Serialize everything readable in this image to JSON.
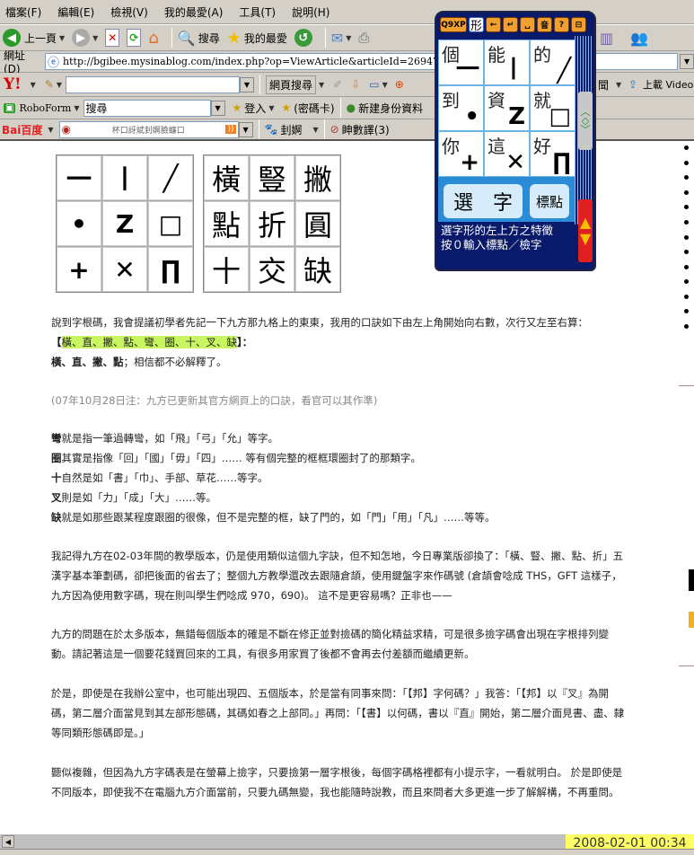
{
  "menu": [
    "檔案(F)",
    "編輯(E)",
    "檢視(V)",
    "我的最愛(A)",
    "工具(T)",
    "說明(H)"
  ],
  "toolbar": {
    "back": "上一頁",
    "search": "搜尋",
    "favorites": "我的最愛"
  },
  "address": {
    "label": "網址(D)",
    "url": "http://bgibee.mysinablog.com/index.php?op=ViewArticle&articleId=269475"
  },
  "yahoo": {
    "logo": "Y!",
    "search_value": "",
    "web_search": "網頁搜尋",
    "news": "聞",
    "upload": "上載 Video"
  },
  "roboform": {
    "label": "RoboForm",
    "search_value": "搜尋",
    "login": "登入",
    "passcard": "(密碼卡)",
    "new_identity": "新建身份資料"
  },
  "baidu": {
    "logo": "Bai百度",
    "input_text": "杯口訝斌刲婀臉蠊口",
    "btn1": "刲婀",
    "btn2": "眒數譯(3)"
  },
  "ime": {
    "buttons": [
      "Q9XP",
      "形",
      "←",
      "↵",
      "␣",
      "音",
      "?",
      "⊟"
    ],
    "cells": [
      {
        "char": "個",
        "stroke": "一"
      },
      {
        "char": "能",
        "stroke": "丨"
      },
      {
        "char": "的",
        "stroke": "╱"
      },
      {
        "char": "到",
        "stroke": "•"
      },
      {
        "char": "資",
        "stroke": "Z"
      },
      {
        "char": "就",
        "stroke": "□"
      },
      {
        "char": "你",
        "stroke": "+"
      },
      {
        "char": "這",
        "stroke": "✕"
      },
      {
        "char": "好",
        "stroke": "∏"
      }
    ],
    "select_label": "選　字",
    "punct_label": "標點",
    "hint_line1": "選字形的左上方之特徵",
    "hint_line2": "按０輸入標點／檢字"
  },
  "stroke_grid": [
    "一",
    "丨",
    "╱",
    "•",
    "Z",
    "□",
    "+",
    "✕",
    "∏"
  ],
  "name_grid": [
    "橫",
    "豎",
    "撇",
    "點",
    "折",
    "圓",
    "十",
    "交",
    "缺"
  ],
  "article": {
    "p1": "說到字根碼，我會提議初學者先記一下九方那九格上的東東，我用的口訣如下由左上角開始向右數，次行又左至右算：",
    "p1_open": "【",
    "p1_hl": "橫、直、撇、點、彎、圈、十、叉、缺",
    "p1_close": "】：",
    "p1_b": "橫、直、撇、點",
    "p1_rest": "；相信都不必解釋了。",
    "note": "(07年10月28日注：九方已更新其官方網頁上的口訣，看官可以其作準)",
    "l1_b": "彎",
    "l1": "就是指一筆過轉彎，如「飛」「弓」「允」等字。",
    "l2_b": "圈",
    "l2": "其實是指像「回」「國」「毋」「四」…… 等有個完整的框框環圈封了的那類字。",
    "l3_b": "十",
    "l3": "自然是如「書」「巾」、手部、草花……等字。",
    "l4_b": "叉",
    "l4": "則是如「力」「成」「大」……等。",
    "l5_b": "缺",
    "l5": "就是如那些跟某程度跟圈的很像，但不是完整的框，缺了門的，如「門」「用」「凡」……等等。",
    "p3": "我記得九方在02-03年間的教學版本，仍是使用類似這個九字訣，但不知怎地，今日專業版卻換了：「橫、豎、撇、點、折」五漢字基本筆劃碼，卻把後面的省去了；整個九方教學還改去跟隨倉頡，使用鍵盤字來作碼號 (倉頡會唸成 THS，GFT 這樣子，九方因為使用數字碼，現在則叫學生們唸成 970，690)。 這不是更容易嗎？正非也——",
    "p4": "九方的問題在於太多版本，無錯每個版本的確是不斷在修正並對撿碼的簡化精益求精，可是很多撿字碼會出現在字根排列變動。請記著這是一個要花錢買回來的工具，有很多用家買了後都不會再去付差額而繼續更新。",
    "p5": "於是，即使是在我辦公室中，也可能出現四、五個版本，於是當有同事來問：「【邦】字何碼？」我答：「【邦】以『叉』為開碼，第二層介面當見到其左部形態碼，其碼如春之上部同。」再問：「【書】以何碼，書以『直』開始，第二層介面見書、盡、隸等同類形態碼即是。」",
    "p6": "聽似複雜，但因為九方字碼表是在螢幕上撿字，只要撿第一層字根後，每個字碼格裡都有小提示字，一看就明白。 於是即使是不同版本，即使我不在電腦九方介面當前，只要九碼無變，我也能隨時說教，而且來問者大多更進一步了解解構，不再重問。"
  },
  "datetime": "2008-02-01  00:34",
  "colors": {
    "highlight": "#c8f560",
    "ime_bg": "#0a1a6a",
    "ime_btn": "#f0a030",
    "date_bg": "#ffff66"
  }
}
